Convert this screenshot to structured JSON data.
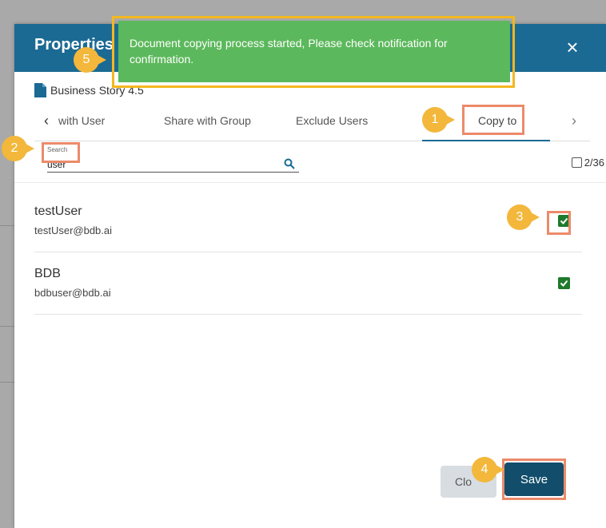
{
  "modal": {
    "title": "Properties",
    "close_label": "×",
    "document_name": "Business Story 4.5"
  },
  "tabs": {
    "items": [
      "with User",
      "Share with Group",
      "Exclude Users",
      "Copy to"
    ],
    "active": "Copy to",
    "prev_arrow": "‹",
    "next_arrow": "›"
  },
  "search": {
    "label": "Search",
    "value": "user",
    "select_all_count": "2/36"
  },
  "users": [
    {
      "name": "testUser",
      "email": "testUser@bdb.ai",
      "checked": true
    },
    {
      "name": "BDB",
      "email": "bdbuser@bdb.ai",
      "checked": true
    }
  ],
  "footer": {
    "close_label": "Clo",
    "save_label": "Save"
  },
  "toast": {
    "message": "Document copying process started, Please check notification for confirmation."
  },
  "markers": [
    "1",
    "2",
    "3",
    "4",
    "5"
  ],
  "colors": {
    "header": "#1b6a93",
    "save_button": "#124e6b",
    "toast": "#5cb85c",
    "checkbox": "#1e7b2c",
    "marker": "#f3b73b",
    "highlight": "#ec8a6a"
  }
}
